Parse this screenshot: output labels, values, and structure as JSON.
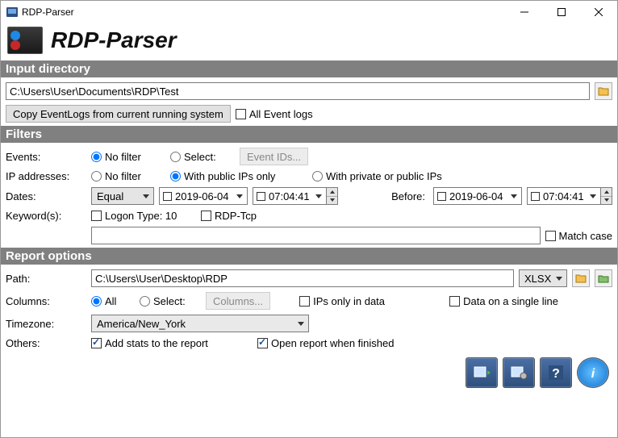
{
  "window": {
    "title": "RDP-Parser",
    "app_title": "RDP-Parser"
  },
  "sections": {
    "input_dir": "Input directory",
    "filters": "Filters",
    "report": "Report options"
  },
  "input": {
    "path_value": "C:\\Users\\User\\Documents\\RDP\\Test",
    "copy_btn": "Copy EventLogs from current running system",
    "all_logs": "All Event logs"
  },
  "filters": {
    "events_lbl": "Events:",
    "no_filter": "No filter",
    "select": "Select:",
    "event_ids_btn": "Event IDs...",
    "ip_lbl": "IP addresses:",
    "public_only": "With public IPs only",
    "private_public": "With private or public IPs",
    "dates_lbl": "Dates:",
    "equal": "Equal",
    "date_a": "2019-06-04",
    "time_a": "07:04:41",
    "before_lbl": "Before:",
    "date_b": "2019-06-04",
    "time_b": "07:04:41",
    "keyword_lbl": "Keyword(s):",
    "kw_logon": "Logon Type: 10",
    "kw_rdp": "RDP-Tcp",
    "keyword_input": "",
    "match_case": "Match case"
  },
  "report": {
    "path_lbl": "Path:",
    "path_value": "C:\\Users\\User\\Desktop\\RDP",
    "format": "XLSX",
    "columns_lbl": "Columns:",
    "all": "All",
    "select": "Select:",
    "columns_btn": "Columns...",
    "ips_only": "IPs only in data",
    "single_line": "Data on a single line",
    "tz_lbl": "Timezone:",
    "tz_value": "America/New_York",
    "others_lbl": "Others:",
    "add_stats": "Add stats to the report",
    "open_report": "Open report when finished"
  }
}
